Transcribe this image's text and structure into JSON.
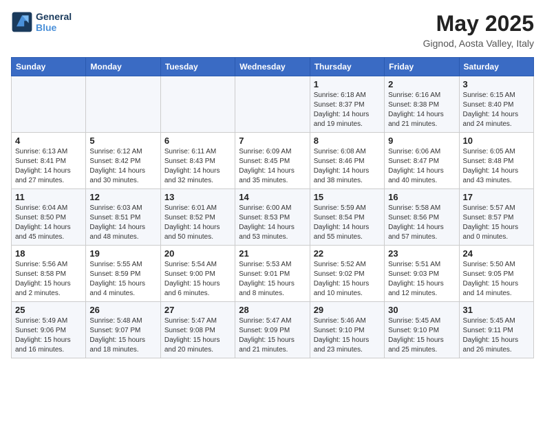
{
  "logo": {
    "line1": "General",
    "line2": "Blue"
  },
  "title": "May 2025",
  "subtitle": "Gignod, Aosta Valley, Italy",
  "weekdays": [
    "Sunday",
    "Monday",
    "Tuesday",
    "Wednesday",
    "Thursday",
    "Friday",
    "Saturday"
  ],
  "weeks": [
    [
      {
        "day": "",
        "info": ""
      },
      {
        "day": "",
        "info": ""
      },
      {
        "day": "",
        "info": ""
      },
      {
        "day": "",
        "info": ""
      },
      {
        "day": "1",
        "info": "Sunrise: 6:18 AM\nSunset: 8:37 PM\nDaylight: 14 hours and 19 minutes."
      },
      {
        "day": "2",
        "info": "Sunrise: 6:16 AM\nSunset: 8:38 PM\nDaylight: 14 hours and 21 minutes."
      },
      {
        "day": "3",
        "info": "Sunrise: 6:15 AM\nSunset: 8:40 PM\nDaylight: 14 hours and 24 minutes."
      }
    ],
    [
      {
        "day": "4",
        "info": "Sunrise: 6:13 AM\nSunset: 8:41 PM\nDaylight: 14 hours and 27 minutes."
      },
      {
        "day": "5",
        "info": "Sunrise: 6:12 AM\nSunset: 8:42 PM\nDaylight: 14 hours and 30 minutes."
      },
      {
        "day": "6",
        "info": "Sunrise: 6:11 AM\nSunset: 8:43 PM\nDaylight: 14 hours and 32 minutes."
      },
      {
        "day": "7",
        "info": "Sunrise: 6:09 AM\nSunset: 8:45 PM\nDaylight: 14 hours and 35 minutes."
      },
      {
        "day": "8",
        "info": "Sunrise: 6:08 AM\nSunset: 8:46 PM\nDaylight: 14 hours and 38 minutes."
      },
      {
        "day": "9",
        "info": "Sunrise: 6:06 AM\nSunset: 8:47 PM\nDaylight: 14 hours and 40 minutes."
      },
      {
        "day": "10",
        "info": "Sunrise: 6:05 AM\nSunset: 8:48 PM\nDaylight: 14 hours and 43 minutes."
      }
    ],
    [
      {
        "day": "11",
        "info": "Sunrise: 6:04 AM\nSunset: 8:50 PM\nDaylight: 14 hours and 45 minutes."
      },
      {
        "day": "12",
        "info": "Sunrise: 6:03 AM\nSunset: 8:51 PM\nDaylight: 14 hours and 48 minutes."
      },
      {
        "day": "13",
        "info": "Sunrise: 6:01 AM\nSunset: 8:52 PM\nDaylight: 14 hours and 50 minutes."
      },
      {
        "day": "14",
        "info": "Sunrise: 6:00 AM\nSunset: 8:53 PM\nDaylight: 14 hours and 53 minutes."
      },
      {
        "day": "15",
        "info": "Sunrise: 5:59 AM\nSunset: 8:54 PM\nDaylight: 14 hours and 55 minutes."
      },
      {
        "day": "16",
        "info": "Sunrise: 5:58 AM\nSunset: 8:56 PM\nDaylight: 14 hours and 57 minutes."
      },
      {
        "day": "17",
        "info": "Sunrise: 5:57 AM\nSunset: 8:57 PM\nDaylight: 15 hours and 0 minutes."
      }
    ],
    [
      {
        "day": "18",
        "info": "Sunrise: 5:56 AM\nSunset: 8:58 PM\nDaylight: 15 hours and 2 minutes."
      },
      {
        "day": "19",
        "info": "Sunrise: 5:55 AM\nSunset: 8:59 PM\nDaylight: 15 hours and 4 minutes."
      },
      {
        "day": "20",
        "info": "Sunrise: 5:54 AM\nSunset: 9:00 PM\nDaylight: 15 hours and 6 minutes."
      },
      {
        "day": "21",
        "info": "Sunrise: 5:53 AM\nSunset: 9:01 PM\nDaylight: 15 hours and 8 minutes."
      },
      {
        "day": "22",
        "info": "Sunrise: 5:52 AM\nSunset: 9:02 PM\nDaylight: 15 hours and 10 minutes."
      },
      {
        "day": "23",
        "info": "Sunrise: 5:51 AM\nSunset: 9:03 PM\nDaylight: 15 hours and 12 minutes."
      },
      {
        "day": "24",
        "info": "Sunrise: 5:50 AM\nSunset: 9:05 PM\nDaylight: 15 hours and 14 minutes."
      }
    ],
    [
      {
        "day": "25",
        "info": "Sunrise: 5:49 AM\nSunset: 9:06 PM\nDaylight: 15 hours and 16 minutes."
      },
      {
        "day": "26",
        "info": "Sunrise: 5:48 AM\nSunset: 9:07 PM\nDaylight: 15 hours and 18 minutes."
      },
      {
        "day": "27",
        "info": "Sunrise: 5:47 AM\nSunset: 9:08 PM\nDaylight: 15 hours and 20 minutes."
      },
      {
        "day": "28",
        "info": "Sunrise: 5:47 AM\nSunset: 9:09 PM\nDaylight: 15 hours and 21 minutes."
      },
      {
        "day": "29",
        "info": "Sunrise: 5:46 AM\nSunset: 9:10 PM\nDaylight: 15 hours and 23 minutes."
      },
      {
        "day": "30",
        "info": "Sunrise: 5:45 AM\nSunset: 9:10 PM\nDaylight: 15 hours and 25 minutes."
      },
      {
        "day": "31",
        "info": "Sunrise: 5:45 AM\nSunset: 9:11 PM\nDaylight: 15 hours and 26 minutes."
      }
    ]
  ]
}
